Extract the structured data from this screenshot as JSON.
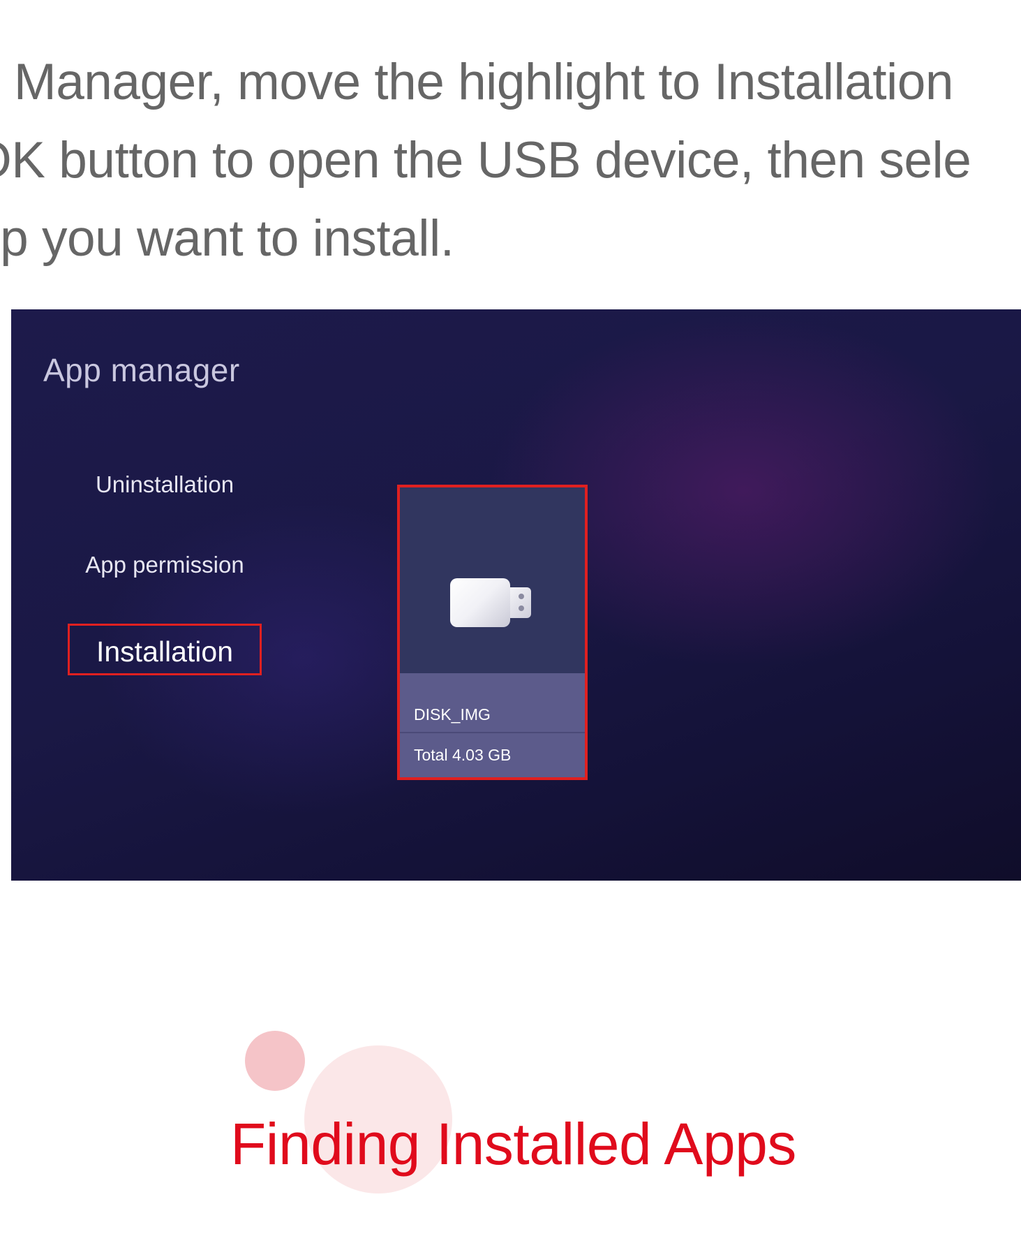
{
  "intro": {
    "lines": [
      "p Manager,  move the highlight to Installation",
      " OK button to open the USB device, then sele",
      "op you want to install."
    ]
  },
  "tv_screen": {
    "title": "App manager",
    "menu": [
      {
        "label": "Uninstallation",
        "selected": false
      },
      {
        "label": "App permission",
        "selected": false
      },
      {
        "label": "Installation",
        "selected": true
      }
    ],
    "device": {
      "icon": "usb-drive-icon",
      "name": "DISK_IMG",
      "size": "Total 4.03 GB"
    },
    "highlight_color": "#e02020"
  },
  "section": {
    "heading": "Finding Installed Apps",
    "heading_color": "#e00b1c"
  }
}
